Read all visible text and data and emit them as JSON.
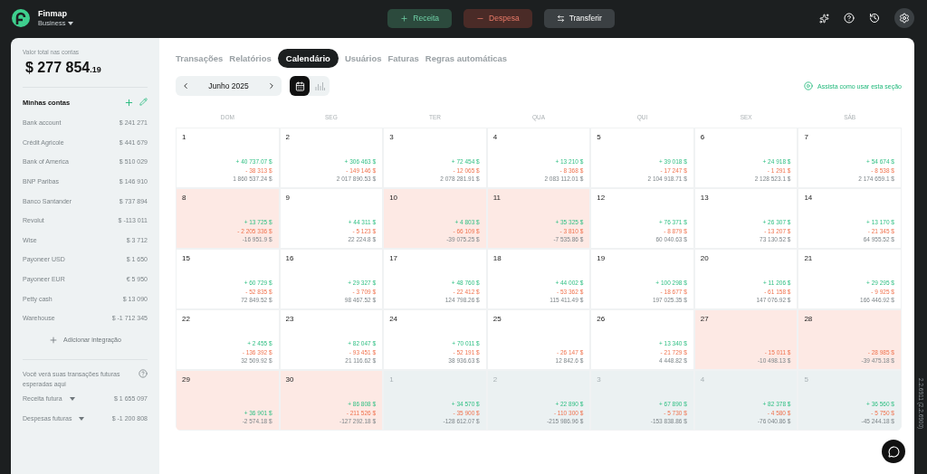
{
  "app": {
    "name": "Finmap",
    "workspace": "Business"
  },
  "actions": [
    {
      "kind": "income",
      "label": "Receita"
    },
    {
      "kind": "expense",
      "label": "Despesa"
    },
    {
      "kind": "transfer",
      "label": "Transferir"
    }
  ],
  "sidebar": {
    "total_label": "Valor total nas contas",
    "total_amount": "$ 277 854",
    "total_cents": ".19",
    "accounts_title": "Minhas contas",
    "accounts": [
      {
        "name": "Bank account",
        "balance": "$ 241 271"
      },
      {
        "name": "Crédit Agricole",
        "balance": "$ 441 679"
      },
      {
        "name": "Bank of America",
        "balance": "$ 510 029"
      },
      {
        "name": "BNP Paribas",
        "balance": "$ 146 910"
      },
      {
        "name": "Banco Santander",
        "balance": "$ 737 894"
      },
      {
        "name": "Revolut",
        "balance": "$ -113 011"
      },
      {
        "name": "Wise",
        "balance": "$ 3 712"
      },
      {
        "name": "Payoneer USD",
        "balance": "$ 1 650"
      },
      {
        "name": "Payoneer EUR",
        "balance": "€ 5 950"
      },
      {
        "name": "Petty cash",
        "balance": "$ 13 090"
      },
      {
        "name": "Warehouse",
        "balance": "$ -1 712 345"
      }
    ],
    "add_integration": "Adicionar integração",
    "future_note": "Você verá suas transações futuras esperadas aqui",
    "future": [
      {
        "label": "Receita futura",
        "amount": "$ 1 655 097"
      },
      {
        "label": "Despesas futuras",
        "amount": "$ -1 200 808"
      }
    ]
  },
  "tabs": [
    {
      "label": "Transações",
      "selected": false
    },
    {
      "label": "Relatórios",
      "selected": false
    },
    {
      "label": "Calendário",
      "selected": true
    },
    {
      "label": "Usuários",
      "selected": false
    },
    {
      "label": "Faturas",
      "selected": false
    },
    {
      "label": "Regras automáticas",
      "selected": false
    }
  ],
  "month": "Junho 2025",
  "views": [
    {
      "kind": "calendar",
      "selected": true
    },
    {
      "kind": "chart",
      "selected": false
    }
  ],
  "help_link": "Assista como usar esta seção",
  "weekdays": [
    "DOM",
    "SEG",
    "TER",
    "QUA",
    "QUI",
    "SEX",
    "SÁB"
  ],
  "weeks": [
    [
      {
        "day": "1",
        "income": "+ 40 737.07 $",
        "expense": "- 38 313 $",
        "balance": "1 860 537.24 $",
        "negative": false,
        "other_month": false
      },
      {
        "day": "2",
        "income": "+ 306 463 $",
        "expense": "- 149 146 $",
        "balance": "2 017 890.53 $",
        "negative": false,
        "other_month": false
      },
      {
        "day": "3",
        "income": "+ 72 454 $",
        "expense": "- 12 065 $",
        "balance": "2 078 281.91 $",
        "negative": false,
        "other_month": false
      },
      {
        "day": "4",
        "income": "+ 13 210 $",
        "expense": "- 8 368 $",
        "balance": "2 083 112.01 $",
        "negative": false,
        "other_month": false
      },
      {
        "day": "5",
        "income": "+ 39 018 $",
        "expense": "- 17 247 $",
        "balance": "2 104 918.71 $",
        "negative": false,
        "other_month": false
      },
      {
        "day": "6",
        "income": "+ 24 918 $",
        "expense": "- 1 291 $",
        "balance": "2 128 523.1 $",
        "negative": false,
        "other_month": false
      },
      {
        "day": "7",
        "income": "+ 54 674 $",
        "expense": "- 8 538 $",
        "balance": "2 174 659.1 $",
        "negative": false,
        "other_month": false
      }
    ],
    [
      {
        "day": "8",
        "income": "+ 13 725 $",
        "expense": "- 2 205 336 $",
        "balance": "-16 951.9 $",
        "negative": true,
        "other_month": false
      },
      {
        "day": "9",
        "income": "+ 44 311 $",
        "expense": "- 5 123 $",
        "balance": "22 224.8 $",
        "negative": false,
        "other_month": false
      },
      {
        "day": "10",
        "income": "+ 4 803 $",
        "expense": "- 66 109 $",
        "balance": "-39 075.25 $",
        "negative": true,
        "other_month": false
      },
      {
        "day": "11",
        "income": "+ 35 325 $",
        "expense": "- 3 810 $",
        "balance": "-7 535.86 $",
        "negative": true,
        "other_month": false
      },
      {
        "day": "12",
        "income": "+ 76 371 $",
        "expense": "- 8 879 $",
        "balance": "60 040.63 $",
        "negative": false,
        "other_month": false
      },
      {
        "day": "13",
        "income": "+ 26 307 $",
        "expense": "- 13 207 $",
        "balance": "73 130.52 $",
        "negative": false,
        "other_month": false
      },
      {
        "day": "14",
        "income": "+ 13 170 $",
        "expense": "- 21 345 $",
        "balance": "64 955.52 $",
        "negative": false,
        "other_month": false
      }
    ],
    [
      {
        "day": "15",
        "income": "+ 60 729 $",
        "expense": "- 52 835 $",
        "balance": "72 849.52 $",
        "negative": false,
        "other_month": false
      },
      {
        "day": "16",
        "income": "+ 29 327 $",
        "expense": "- 3 709 $",
        "balance": "98 467.52 $",
        "negative": false,
        "other_month": false
      },
      {
        "day": "17",
        "income": "+ 48 760 $",
        "expense": "- 22 412 $",
        "balance": "124 798.26 $",
        "negative": false,
        "other_month": false
      },
      {
        "day": "18",
        "income": "+ 44 002 $",
        "expense": "- 53 362 $",
        "balance": "115 411.49 $",
        "negative": false,
        "other_month": false
      },
      {
        "day": "19",
        "income": "+ 100 298 $",
        "expense": "- 18 677 $",
        "balance": "197 025.35 $",
        "negative": false,
        "other_month": false
      },
      {
        "day": "20",
        "income": "+ 11 206 $",
        "expense": "- 61 158 $",
        "balance": "147 076.92 $",
        "negative": false,
        "other_month": false
      },
      {
        "day": "21",
        "income": "+ 29 295 $",
        "expense": "- 9 925 $",
        "balance": "166 446.92 $",
        "negative": false,
        "other_month": false
      }
    ],
    [
      {
        "day": "22",
        "income": "+ 2 455 $",
        "expense": "- 136 392 $",
        "balance": "32 509.92 $",
        "negative": false,
        "other_month": false
      },
      {
        "day": "23",
        "income": "+ 82 047 $",
        "expense": "- 93 451 $",
        "balance": "21 116.62 $",
        "negative": false,
        "other_month": false
      },
      {
        "day": "24",
        "income": "+ 70 011 $",
        "expense": "- 52 191 $",
        "balance": "38 936.63 $",
        "negative": false,
        "other_month": false
      },
      {
        "day": "25",
        "expense": "- 26 147 $",
        "balance": "12 842.6 $",
        "negative": false,
        "other_month": false
      },
      {
        "day": "26",
        "income": "+ 13 340 $",
        "expense": "- 21 729 $",
        "balance": "4 448.82 $",
        "negative": false,
        "other_month": false
      },
      {
        "day": "27",
        "expense": "- 15 011 $",
        "balance": "-10 498.13 $",
        "negative": true,
        "other_month": false
      },
      {
        "day": "28",
        "expense": "- 28 985 $",
        "balance": "-39 475.18 $",
        "negative": true,
        "other_month": false
      }
    ],
    [
      {
        "day": "29",
        "income": "+ 36 901 $",
        "balance": "-2 574.18 $",
        "negative": true,
        "other_month": false
      },
      {
        "day": "30",
        "income": "+ 86 808 $",
        "expense": "- 211 526 $",
        "balance": "-127 292.18 $",
        "negative": true,
        "other_month": false
      },
      {
        "day": "1",
        "income": "+ 34 570 $",
        "expense": "- 35 900 $",
        "balance": "-128 612.07 $",
        "negative": false,
        "other_month": true
      },
      {
        "day": "2",
        "income": "+ 22 890 $",
        "expense": "- 110 300 $",
        "balance": "-215 986.96 $",
        "negative": false,
        "other_month": true
      },
      {
        "day": "3",
        "income": "+ 67 890 $",
        "expense": "- 5 730 $",
        "balance": "-153 838.86 $",
        "negative": false,
        "other_month": true
      },
      {
        "day": "4",
        "income": "+ 82 378 $",
        "expense": "- 4 580 $",
        "balance": "-76 040.86 $",
        "negative": false,
        "other_month": true
      },
      {
        "day": "5",
        "income": "+ 36 560 $",
        "expense": "- 5 750 $",
        "balance": "-45 244.18 $",
        "negative": false,
        "other_month": true
      }
    ]
  ],
  "version": "2.2.6911 (2.2.6900)"
}
